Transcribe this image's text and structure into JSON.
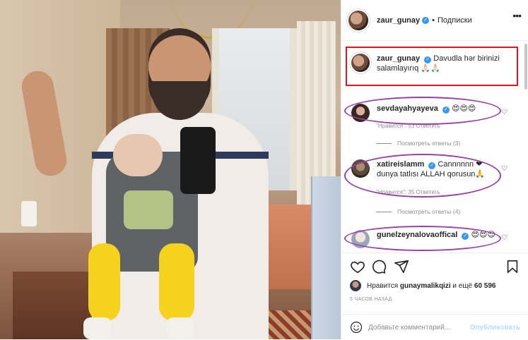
{
  "post": {
    "author": "zaur_gunay",
    "follow_label": "Подписки",
    "separator": "•",
    "verified_mark": "✓"
  },
  "caption": {
    "username": "zaur_gunay",
    "text": "Davudla hər birinizi salamlayırıq 🙏🏻🙏🏻"
  },
  "comments": [
    {
      "username": "sevdayahyayeva",
      "text": "😍😍😍",
      "meta": "\"Нравится\": 53    Ответить",
      "replies": "Посмотреть ответы (3)"
    },
    {
      "username": "xatireislamm",
      "text": "Cannnnnn ❤ dunya tatlısı ALLAH qorusun🙏",
      "meta": "\"Нравится\": 35    Ответить",
      "replies": "Посмотреть ответы (4)"
    },
    {
      "username": "gunelzeynalovaoffical",
      "text": "😍😍😍"
    }
  ],
  "likes": {
    "prefix": "Нравится",
    "user": "gunaymalikqizi",
    "suffix": "и ещё",
    "count": "60 596"
  },
  "time_ago": "5 ЧАСОВ НАЗАД",
  "add_comment": {
    "placeholder": "Добавьте комментарий...",
    "publish_label": "Опубликовать"
  },
  "colors": {
    "caption_highlight": "#e2161b",
    "comment_highlight": "#9b3fa8",
    "verified": "#3897f0",
    "publish": "#b2dffc"
  },
  "icons": [
    "heart-icon",
    "comment-icon",
    "share-icon",
    "bookmark-icon",
    "emoji-icon",
    "more-icon"
  ]
}
